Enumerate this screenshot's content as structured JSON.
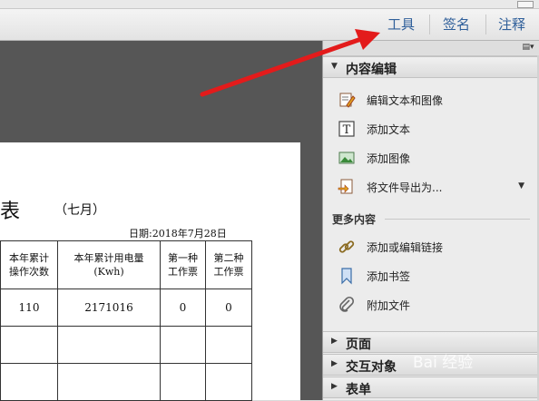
{
  "toolbar": {
    "tools": "工具",
    "sign": "签名",
    "comment": "注释"
  },
  "document": {
    "title_char": "表",
    "subtitle": "（七月）",
    "date": "日期:2018年7月28日",
    "headers": [
      "本年累计\n操作次数",
      "本年累计用电量\n(Kwh)",
      "第一种\n工作票",
      "第二种\n工作票"
    ],
    "row": [
      "110",
      "2171016",
      "0",
      "0"
    ]
  },
  "panel": {
    "content_edit": {
      "title": "内容编辑",
      "items": [
        {
          "label": "编辑文本和图像",
          "icon": "edit-text-image-icon"
        },
        {
          "label": "添加文本",
          "icon": "add-text-icon"
        },
        {
          "label": "添加图像",
          "icon": "add-image-icon"
        },
        {
          "label": "将文件导出为...",
          "icon": "export-file-icon"
        }
      ]
    },
    "more_content": {
      "title": "更多内容",
      "items": [
        {
          "label": "添加或编辑链接",
          "icon": "link-icon"
        },
        {
          "label": "添加书签",
          "icon": "bookmark-icon"
        },
        {
          "label": "附加文件",
          "icon": "paperclip-icon"
        }
      ]
    },
    "sections": [
      "页面",
      "交互对象",
      "表单"
    ]
  },
  "watermark": "Bai 经验",
  "colors": {
    "accent_link": "#2f5f9a",
    "arrow": "#e31b1b",
    "doc_background": "#565656"
  }
}
